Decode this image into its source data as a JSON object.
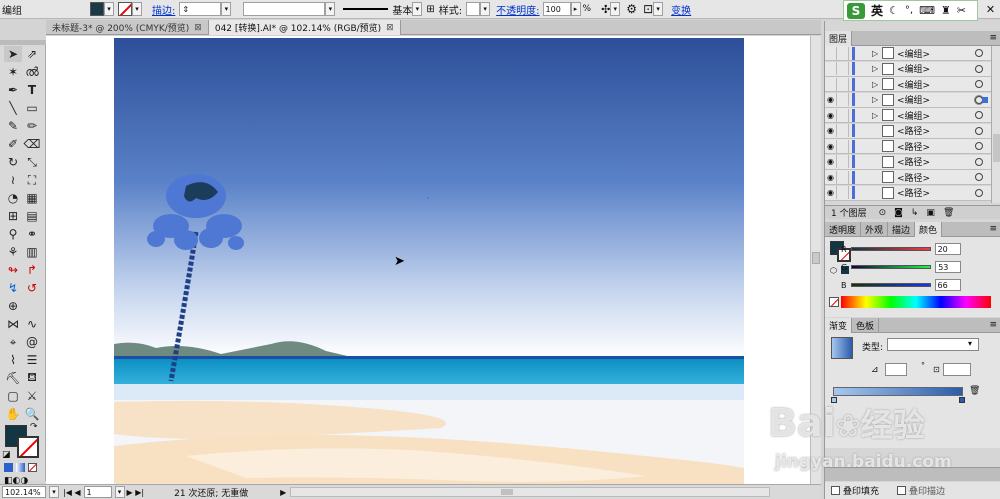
{
  "control_bar": {
    "selection_label": "编组",
    "fill_color": "#1a3a48",
    "stroke_label": "描边:",
    "brush_label": "基本",
    "style_label": "样式:",
    "opacity_label": "不透明度:",
    "opacity_value": "100",
    "opacity_unit": "%",
    "transform_link": "变换"
  },
  "ime_bar": {
    "lang": "英",
    "logo": "S"
  },
  "tabs": [
    {
      "label": "未标题-3* @ 200% (CMYK/预览)",
      "active": false
    },
    {
      "label": "042 [转换].AI* @ 102.14% (RGB/预览)",
      "active": true
    }
  ],
  "status_bar": {
    "zoom": "102.14%",
    "page": "1",
    "status_text": "21 次还原; 无重做"
  },
  "layers_panel": {
    "title": "图层",
    "rows": [
      {
        "name": "<编组>",
        "visible": false,
        "expand": true
      },
      {
        "name": "<编组>",
        "visible": false,
        "expand": true
      },
      {
        "name": "<编组>",
        "visible": false,
        "expand": true
      },
      {
        "name": "<编组>",
        "visible": true,
        "expand": true,
        "selected": true
      },
      {
        "name": "<编组>",
        "visible": true,
        "expand": true
      },
      {
        "name": "<路径>",
        "visible": true,
        "expand": false
      },
      {
        "name": "<路径>",
        "visible": true,
        "expand": false
      },
      {
        "name": "<路径>",
        "visible": true,
        "expand": false
      },
      {
        "name": "<路径>",
        "visible": true,
        "expand": false
      },
      {
        "name": "<路径>",
        "visible": true,
        "expand": false
      }
    ],
    "footer": "1 个图层"
  },
  "color_panel": {
    "tabs": [
      "透明度",
      "外观",
      "描边",
      "颜色"
    ],
    "r_label": "R",
    "g_label": "G",
    "b_label": "B",
    "r": "20",
    "g": "53",
    "b": "66",
    "fill_swatch": "#143542"
  },
  "gradient_panel": {
    "tabs": [
      "渐变",
      "色板"
    ],
    "type_label": "类型:",
    "angle_unit": "°",
    "start_color": "#a6c8ee",
    "end_color": "#2b5cab"
  },
  "bottom_panel": {
    "fill_overprint": "叠印填充",
    "stroke_overprint": "叠印描边"
  },
  "watermark": {
    "logo": "Bai",
    "cn": "经验",
    "url": "jingyan.baidu.com"
  }
}
